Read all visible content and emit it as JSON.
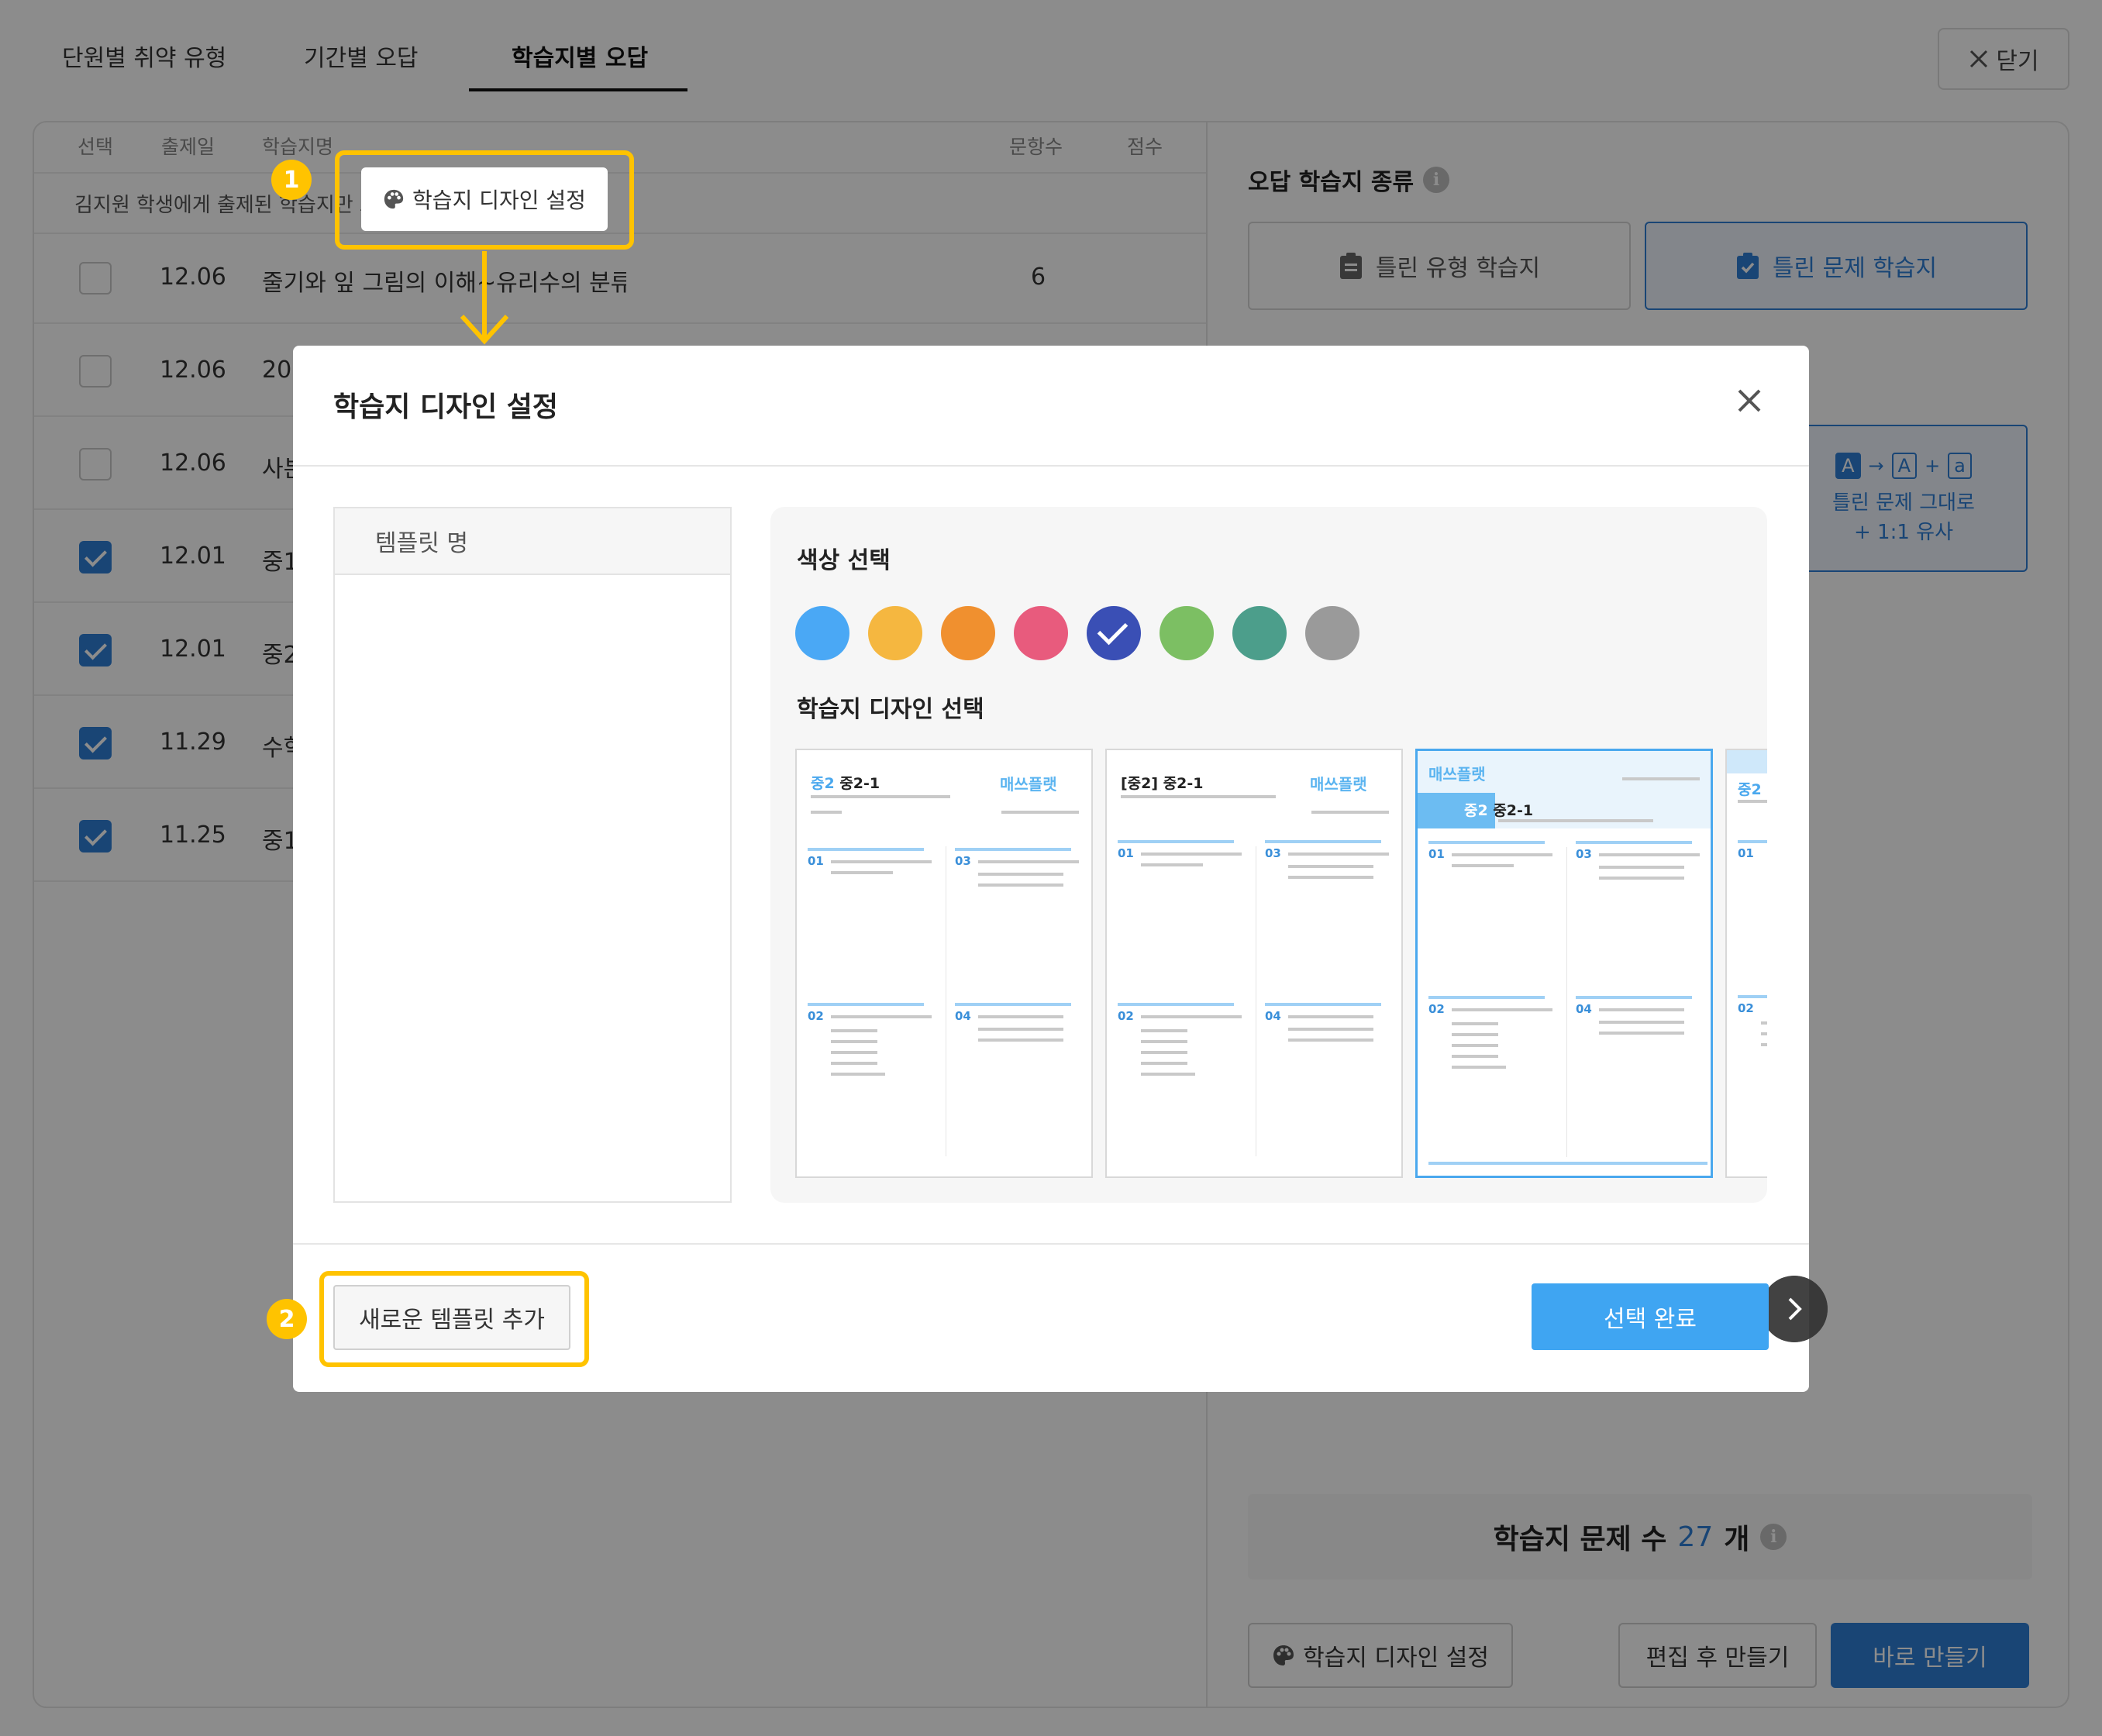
{
  "tabs": [
    {
      "label": "단원별 취약 유형"
    },
    {
      "label": "기간별 오답"
    },
    {
      "label": "학습지별 오답"
    }
  ],
  "close_label": "닫기",
  "table": {
    "headers": [
      "선택",
      "출제일",
      "학습지명",
      "문항수",
      "점수"
    ],
    "notice": "김지원 학생에게 출제된 학습지만 노",
    "rows": [
      {
        "checked": false,
        "date": "12.06",
        "name": "줄기와 잎 그림의 이해~유리수의 분류",
        "count": "6"
      },
      {
        "checked": false,
        "date": "12.06",
        "name": "20",
        "count": ""
      },
      {
        "checked": false,
        "date": "12.06",
        "name": "사본",
        "count": ""
      },
      {
        "checked": true,
        "date": "12.01",
        "name": "중1",
        "count": ""
      },
      {
        "checked": true,
        "date": "12.01",
        "name": "중2",
        "count": ""
      },
      {
        "checked": true,
        "date": "11.29",
        "name": "수학",
        "count": ""
      },
      {
        "checked": true,
        "date": "11.25",
        "name": "중1",
        "count": ""
      }
    ]
  },
  "right_panel": {
    "title": "오답 학습지 종류",
    "type_wrong_type": "틀린 유형 학습지",
    "type_wrong_problem": "틀린 문제 학습지",
    "sub_glyph_a": "A",
    "sub_glyph_arrow": "→",
    "sub_glyph_a2": "A",
    "sub_glyph_plus": "+",
    "sub_glyph_a3": "a",
    "sub_line1": "틀린 문제 그대로",
    "sub_line2": "+ 1:1 유사",
    "count_label": "학습지 문제 수",
    "count_value": "27",
    "count_unit": "개",
    "design_btn": "학습지 디자인 설정",
    "edit_btn": "편집 후 만들기",
    "make_btn": "바로 만들기"
  },
  "callout": {
    "button_label": "학습지 디자인 설정",
    "badge1": "1",
    "badge2": "2"
  },
  "modal": {
    "title": "학습지 디자인 설정",
    "template_header": "템플릿 명",
    "color_label": "색상 선택",
    "design_label": "학습지 디자인 선택",
    "add_template": "새로운 템플릿 추가",
    "done": "선택 완료",
    "colors": [
      "#4aa8f5",
      "#f5b740",
      "#f0902f",
      "#e85b7d",
      "#3a4fb5",
      "#7cbf63",
      "#4c9e8b",
      "#9a9a9a"
    ],
    "selected_color_index": 4,
    "thumbnails": [
      {
        "level": "중2",
        "title": "중2-1",
        "brand": "매쓰플랫",
        "q1": "01",
        "q2": "02",
        "q3": "03",
        "q4": "04"
      },
      {
        "level": "[중2]",
        "title": "중2-1",
        "brand": "매쓰플랫",
        "q1": "01",
        "q2": "02",
        "q3": "03",
        "q4": "04"
      },
      {
        "level": "중2",
        "title": "중2-1",
        "brand": "매쓰플랫",
        "q1": "01",
        "q2": "02",
        "q3": "03",
        "q4": "04"
      },
      {
        "level": "중2",
        "q1": "01",
        "q2": "02"
      }
    ]
  }
}
